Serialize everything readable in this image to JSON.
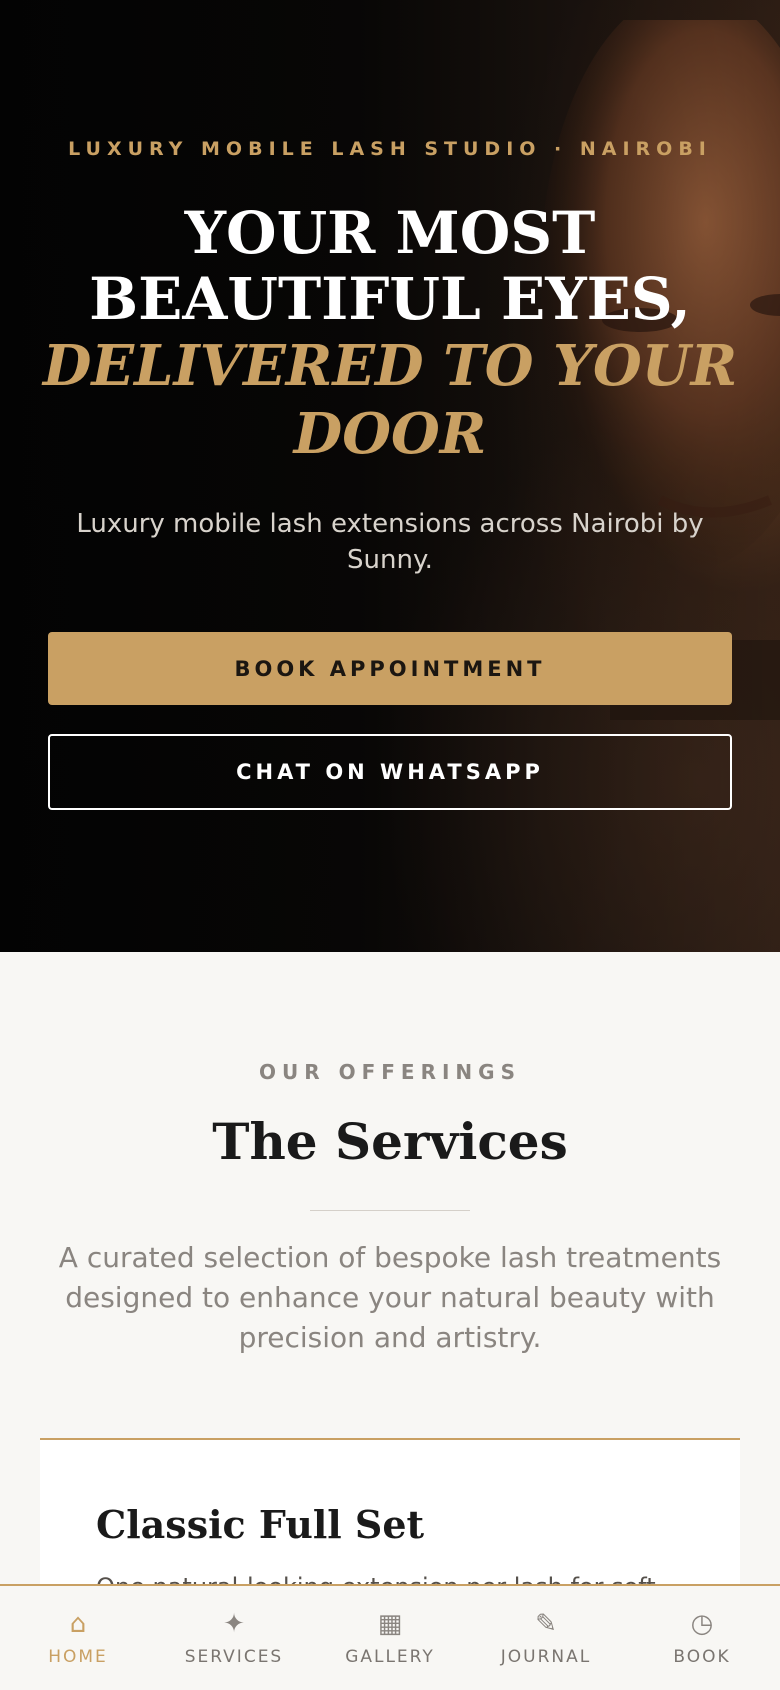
{
  "hero": {
    "eyebrow": "LUXURY MOBILE LASH STUDIO · NAIROBI",
    "headline_line1": "YOUR MOST",
    "headline_line2": "BEAUTIFUL EYES,",
    "headline_accent_line1": "DELIVERED TO YOUR",
    "headline_accent_line2": "DOOR",
    "tagline": "Luxury mobile lash extensions across Nairobi by Sunny.",
    "book_button": "BOOK APPOINTMENT",
    "whatsapp_button": "CHAT ON WHATSAPP"
  },
  "services": {
    "eyebrow": "OUR OFFERINGS",
    "title": "The Services",
    "description": "A curated selection of bespoke lash treatments designed to enhance your natural beauty with precision and artistry.",
    "cards": [
      {
        "title": "Classic Full Set",
        "description": "One natural-looking extension per lash for soft"
      }
    ]
  },
  "bottom_nav": {
    "items": [
      {
        "label": "HOME",
        "icon": "home-icon",
        "glyph": "⌂",
        "active": true
      },
      {
        "label": "SERVICES",
        "icon": "sparkle-icon",
        "glyph": "✦",
        "active": false
      },
      {
        "label": "GALLERY",
        "icon": "grid-icon",
        "glyph": "▦",
        "active": false
      },
      {
        "label": "JOURNAL",
        "icon": "pencil-icon",
        "glyph": "✎",
        "active": false
      },
      {
        "label": "BOOK",
        "icon": "clock-icon",
        "glyph": "◷",
        "active": false
      }
    ]
  },
  "colors": {
    "accent_gold": "#c9a063",
    "hero_dark": "#0b0908",
    "page_bg": "#f8f7f4",
    "text_dark": "#1a1a1a",
    "text_muted": "#8a8580"
  }
}
